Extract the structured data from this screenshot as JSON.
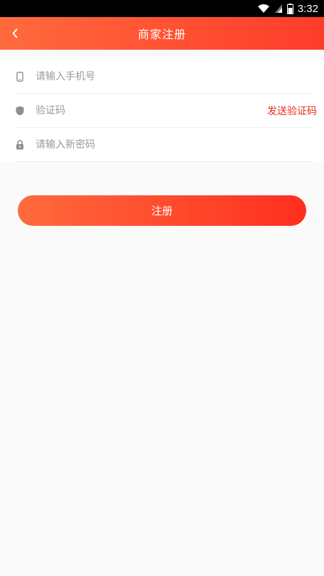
{
  "status_bar": {
    "time": "3:32",
    "icons": [
      "wifi-icon",
      "signal-icon",
      "battery-icon"
    ]
  },
  "header": {
    "title": "商家注册",
    "back_icon": "chevron-left-icon"
  },
  "form": {
    "phone": {
      "placeholder": "请输入手机号",
      "value": "",
      "icon": "phone-icon"
    },
    "code": {
      "placeholder": "验证码",
      "value": "",
      "icon": "shield-icon",
      "send_label": "发送验证码"
    },
    "password": {
      "placeholder": "请输入新密码",
      "value": "",
      "icon": "lock-icon"
    }
  },
  "submit_label": "注册",
  "colors": {
    "accent_start": "#ff6a3d",
    "accent_end": "#ff3c2a",
    "link_red": "#e8301f",
    "background": "#fafafa"
  }
}
